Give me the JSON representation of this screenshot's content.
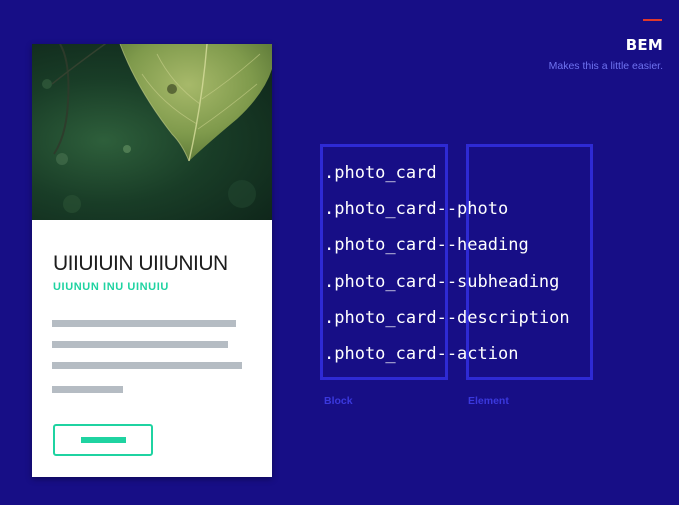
{
  "header": {
    "title": "BEM",
    "subtitle": "Makes this a little easier."
  },
  "card": {
    "heading": "UIIUIUIN UIIUNIUN",
    "subheading": "UIUNUN INU UINUIU",
    "description_lines": 4,
    "action_label": ""
  },
  "code": {
    "lines": [
      ".photo_card",
      ".photo_card--photo",
      ".photo_card--heading",
      ".photo_card--subheading",
      ".photo_card--description",
      ".photo_card--action"
    ]
  },
  "labels": {
    "block": "Block",
    "element": "Element"
  },
  "colors": {
    "background": "#170e86",
    "accent_red": "#e0392b",
    "accent_green": "#1fd3a1",
    "bracket": "#2e2ad4",
    "subtitle": "#6f73f0",
    "placeholder_gray": "#b5bcc3"
  },
  "icons": {
    "photo": "leaf-photo"
  }
}
